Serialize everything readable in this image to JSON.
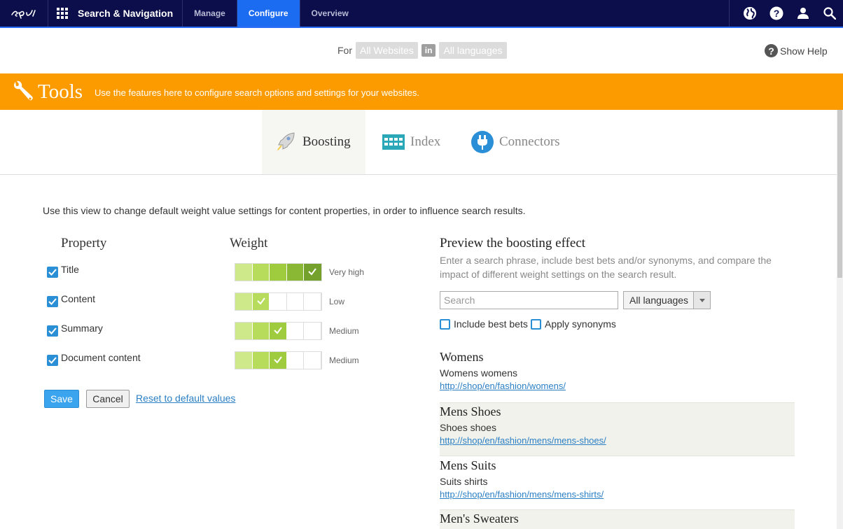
{
  "nav": {
    "app_title": "Search & Navigation",
    "tabs": [
      {
        "label": "Manage",
        "active": false
      },
      {
        "label": "Configure",
        "active": true
      },
      {
        "label": "Overview",
        "active": false
      }
    ],
    "icons": [
      "globe-icon",
      "help-icon",
      "user-icon",
      "search-icon"
    ]
  },
  "context": {
    "for_label": "For",
    "site_chip": "All Websites",
    "in_label": "in",
    "language_chip": "All languages",
    "show_help": "Show Help"
  },
  "banner": {
    "title": "Tools",
    "description": "Use the features here to configure search options and settings for your websites.",
    "color": "#fb9b00"
  },
  "subtabs": [
    {
      "label": "Boosting",
      "icon": "rocket-icon",
      "active": true
    },
    {
      "label": "Index",
      "icon": "grid-icon",
      "active": false
    },
    {
      "label": "Connectors",
      "icon": "plug-icon",
      "active": false
    }
  ],
  "boosting": {
    "intro": "Use this view to change default weight value settings for content properties, in order to influence search results.",
    "property_header": "Property",
    "weight_header": "Weight",
    "properties": [
      {
        "label": "Title",
        "checked": true,
        "level": 5,
        "weight_label": "Very high"
      },
      {
        "label": "Content",
        "checked": true,
        "level": 2,
        "weight_label": "Low"
      },
      {
        "label": "Summary",
        "checked": true,
        "level": 3,
        "weight_label": "Medium"
      },
      {
        "label": "Document content",
        "checked": true,
        "level": 3,
        "weight_label": "Medium"
      }
    ],
    "save_label": "Save",
    "cancel_label": "Cancel",
    "reset_label": "Reset to default values"
  },
  "preview": {
    "title": "Preview the boosting effect",
    "description": "Enter a search phrase, include best bets and/or synonyms, and compare the impact of different weight settings on the search result.",
    "search_placeholder": "Search",
    "language_value": "All languages",
    "include_best_bets": "Include best bets",
    "apply_synonyms": "Apply synonyms",
    "results": [
      {
        "title": "Womens",
        "text": "Womens womens",
        "url": "http://shop/en/fashion/womens/"
      },
      {
        "title": "Mens Shoes",
        "text": "Shoes shoes",
        "url": "http://shop/en/fashion/mens/mens-shoes/"
      },
      {
        "title": "Mens Suits",
        "text": "Suits shirts",
        "url": "http://shop/en/fashion/mens/mens-shirts/"
      },
      {
        "title": "Men's Sweaters",
        "text": "",
        "url": ""
      }
    ]
  }
}
